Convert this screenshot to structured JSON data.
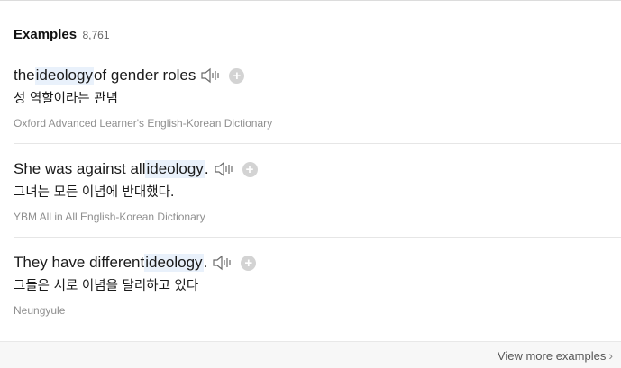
{
  "header": {
    "title": "Examples",
    "count": "8,761"
  },
  "examples": [
    {
      "en_before": "the ",
      "en_highlight": "ideology",
      "en_after": " of gender roles",
      "ko": "성 역할이라는 관념",
      "source": "Oxford Advanced Learner's English-Korean Dictionary"
    },
    {
      "en_before": "She was against all ",
      "en_highlight": "ideology",
      "en_after": ".",
      "ko": "그녀는 모든 이념에 반대했다.",
      "source": "YBM All in All English-Korean Dictionary"
    },
    {
      "en_before": "They have different ",
      "en_highlight": "ideology",
      "en_after": ".",
      "ko": "그들은 서로 이념을 달리하고 있다",
      "source": "Neungyule"
    }
  ],
  "footer": {
    "view_more": "View more examples"
  },
  "icons": {
    "speaker": "speaker-icon",
    "add": "plus-circle-icon",
    "chevron": "chevron-right-icon"
  },
  "colors": {
    "highlight": "#e9f1fb",
    "speaker": "#6b6b6b",
    "add_button": "#d3d3d3"
  }
}
